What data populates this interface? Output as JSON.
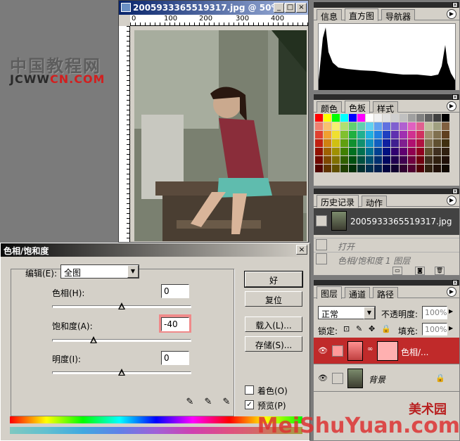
{
  "watermark": {
    "cn": "中国教程网",
    "en_a": "JCWW",
    "en_b": "CN.COM"
  },
  "doc": {
    "title": "2005933365519317.jpg @ 50% (...",
    "ruler": [
      "0",
      "100",
      "200",
      "300",
      "400"
    ]
  },
  "panels": {
    "info_tabs": [
      "信息",
      "直方图",
      "导航器"
    ],
    "color_tabs": [
      "颜色",
      "色板",
      "样式"
    ],
    "history_tabs": [
      "历史记录",
      "动作"
    ],
    "history_snapshot": "2005933365519317.jpg",
    "history_steps": [
      "打开",
      "色相/饱和度 1 图层"
    ],
    "layers_tabs": [
      "图层",
      "通道",
      "路径"
    ],
    "blend_mode": "正常",
    "opacity_label": "不透明度:",
    "opacity_value": "100%",
    "lock_label": "锁定:",
    "fill_label": "填充:",
    "fill_value": "100%",
    "layers": [
      "色相/...",
      "背景"
    ]
  },
  "swatch_colors": [
    "#ff0000",
    "#ffff00",
    "#00ff00",
    "#00ffff",
    "#0000ff",
    "#ff00ff",
    "#ffffff",
    "#f0f0f0",
    "#e0e0e0",
    "#d0d0d0",
    "#c0c0c0",
    "#a0a0a0",
    "#808080",
    "#606060",
    "#404040",
    "#000000",
    "#f08070",
    "#f8c070",
    "#f8f070",
    "#b0e070",
    "#60d070",
    "#60d0b0",
    "#60d0f0",
    "#60a0f0",
    "#6070e0",
    "#8060d0",
    "#b060d0",
    "#e060c0",
    "#e06090",
    "#c0c0a0",
    "#a0a080",
    "#806040",
    "#e04030",
    "#f0a030",
    "#f0e030",
    "#80c030",
    "#20b040",
    "#20b090",
    "#20b0e0",
    "#2080e0",
    "#2040c0",
    "#6030b0",
    "#a030b0",
    "#d03090",
    "#d03060",
    "#a09070",
    "#807050",
    "#604020",
    "#c02010",
    "#d08010",
    "#d0c010",
    "#60a010",
    "#109030",
    "#109070",
    "#1090c0",
    "#1060c0",
    "#1020a0",
    "#402090",
    "#802090",
    "#b01070",
    "#b01040",
    "#807050",
    "#605030",
    "#403010",
    "#901000",
    "#a06000",
    "#a09000",
    "#408000",
    "#007020",
    "#007050",
    "#007090",
    "#004090",
    "#001080",
    "#300070",
    "#600070",
    "#900050",
    "#900020",
    "#605030",
    "#403020",
    "#302010",
    "#700800",
    "#804800",
    "#807000",
    "#306000",
    "#005010",
    "#005040",
    "#005070",
    "#003070",
    "#000860",
    "#200050",
    "#400050",
    "#700040",
    "#700010",
    "#403020",
    "#302010",
    "#201008",
    "#500400",
    "#603400",
    "#605000",
    "#204000",
    "#003008",
    "#003030",
    "#003050",
    "#002050",
    "#000440",
    "#100030",
    "#300030",
    "#500030",
    "#500008",
    "#302010",
    "#201008",
    "#100800"
  ],
  "dialog": {
    "title": "色相/饱和度",
    "edit_label": "编辑(E):",
    "edit_value": "全图",
    "hue_label": "色相(H):",
    "hue_value": "0",
    "sat_label": "饱和度(A):",
    "sat_value": "-40",
    "light_label": "明度(I):",
    "light_value": "0",
    "ok": "好",
    "reset": "复位",
    "load": "载入(L)...",
    "save": "存储(S)...",
    "colorize": "着色(O)",
    "preview": "预览(P)"
  },
  "footer_watermark": {
    "cn": "美术园",
    "en": "MeiShuYuan.com"
  }
}
